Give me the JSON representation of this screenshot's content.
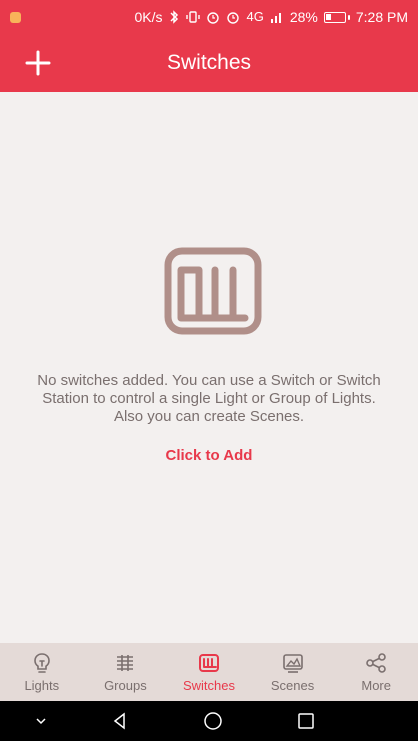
{
  "status": {
    "speed": "0K/s",
    "network": "4G",
    "battery": "28%",
    "time": "7:28 PM",
    "icons": [
      "bluetooth-icon",
      "vibrate-icon",
      "alarm-icon",
      "alarm-icon",
      "signal-icon",
      "battery-icon"
    ]
  },
  "app_bar": {
    "title": "Switches",
    "add_icon": "plus-icon"
  },
  "empty_state": {
    "icon": "switch-panel-icon",
    "message": "No switches added. You can use a Switch or Switch Station to control a single Light or Group of Lights. Also you can create Scenes.",
    "action": "Click to Add"
  },
  "nav": {
    "items": [
      {
        "label": "Lights",
        "icon": "lightbulb-icon"
      },
      {
        "label": "Groups",
        "icon": "groups-icon"
      },
      {
        "label": "Switches",
        "icon": "switch-icon"
      },
      {
        "label": "Scenes",
        "icon": "scene-icon"
      },
      {
        "label": "More",
        "icon": "share-icon"
      }
    ],
    "active": "Switches"
  },
  "system_nav": {
    "icons": [
      "chevron-down-icon",
      "back-icon",
      "home-icon",
      "recent-apps-icon"
    ]
  },
  "colors": {
    "accent": "#e8394b",
    "background": "#f3f0ef",
    "bottom_nav": "#e4dad7",
    "muted_text": "#7a6f6e",
    "icon_brown": "#b08f89"
  }
}
